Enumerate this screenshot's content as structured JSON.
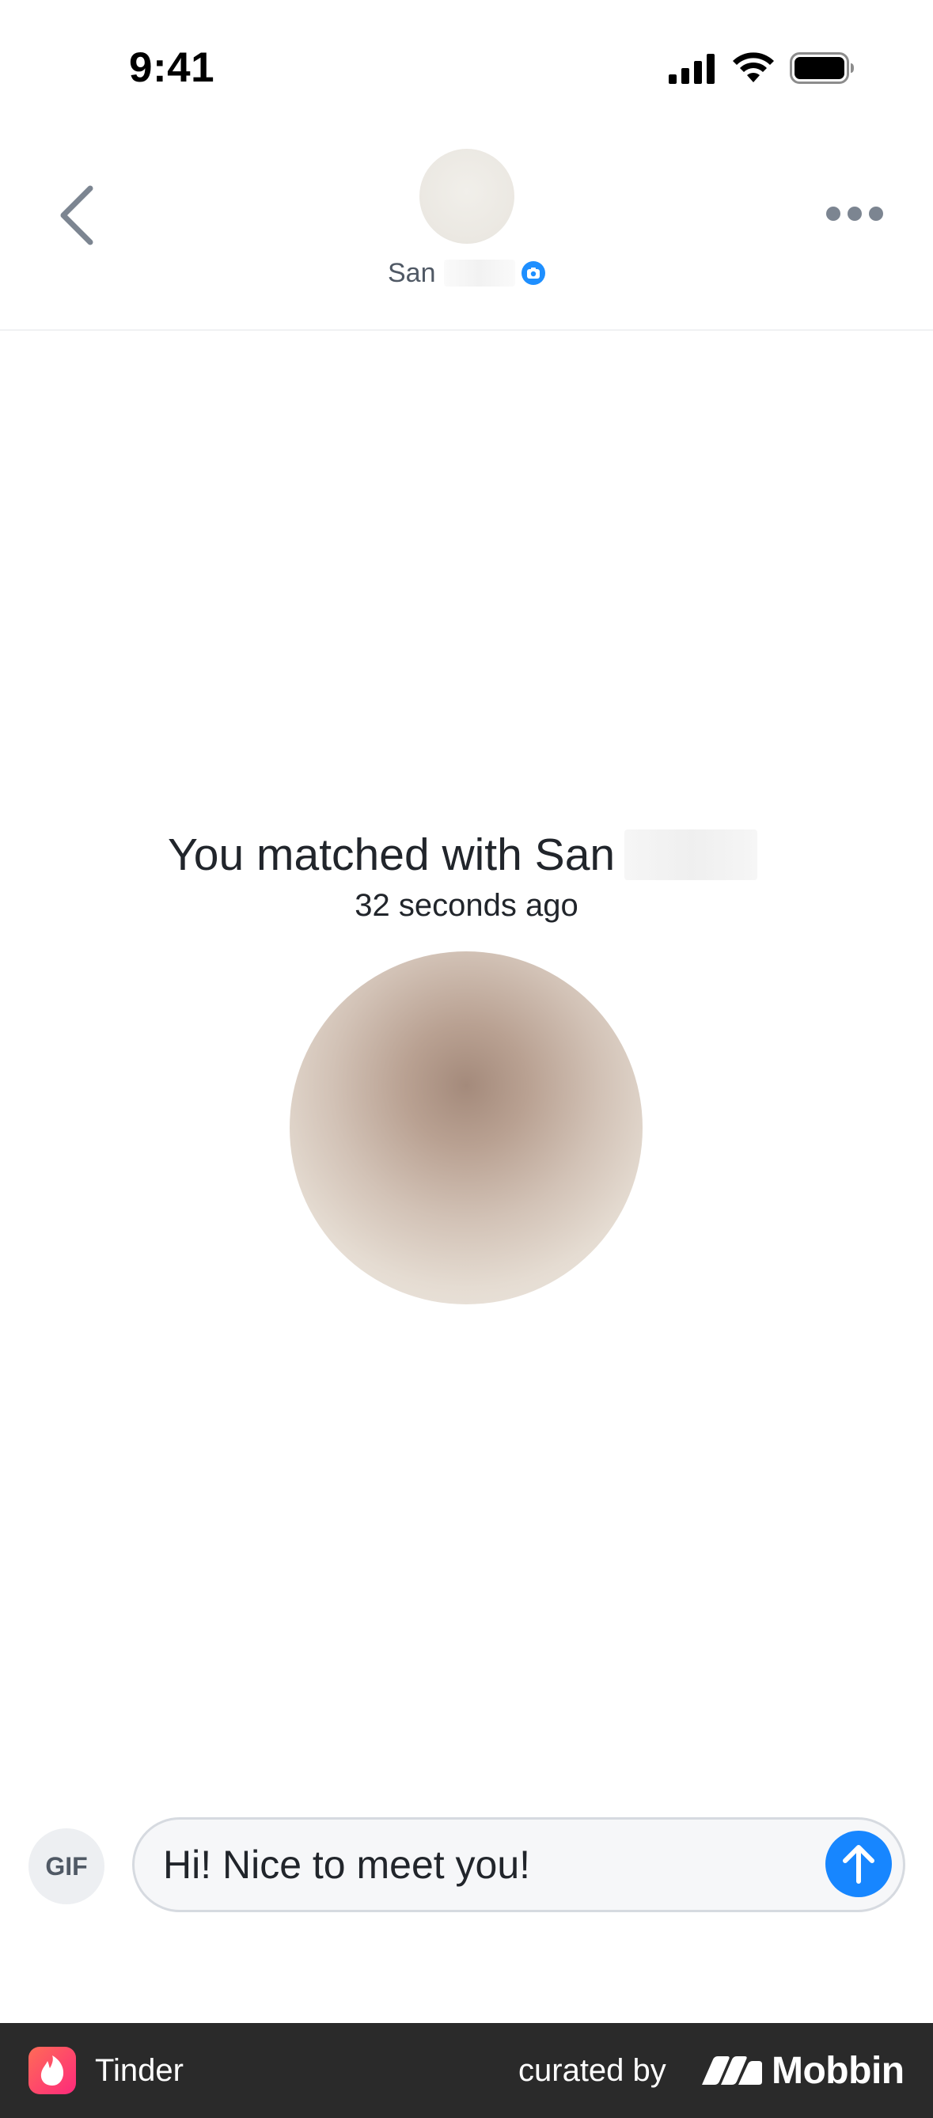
{
  "status_bar": {
    "time": "9:41",
    "icons": [
      "cellular-signal-icon",
      "wifi-icon",
      "battery-icon"
    ]
  },
  "header": {
    "back_icon": "chevron-left-icon",
    "more_icon": "ellipsis-icon",
    "name": "San",
    "badge_icon": "camera-verified-icon"
  },
  "match": {
    "title": "You matched with San",
    "time_ago": "32 seconds ago"
  },
  "composer": {
    "gif_label": "GIF",
    "message_value": "Hi! Nice to meet you!",
    "send_icon": "arrow-up-icon"
  },
  "footer": {
    "app_name": "Tinder",
    "curated_by": "curated by",
    "brand": "Mobbin"
  },
  "colors": {
    "accent_blue": "#1786ff",
    "verified_blue": "#1e8fff",
    "text_primary": "#21252b",
    "text_secondary": "#505965",
    "footer_bg": "#2a2a2a"
  }
}
